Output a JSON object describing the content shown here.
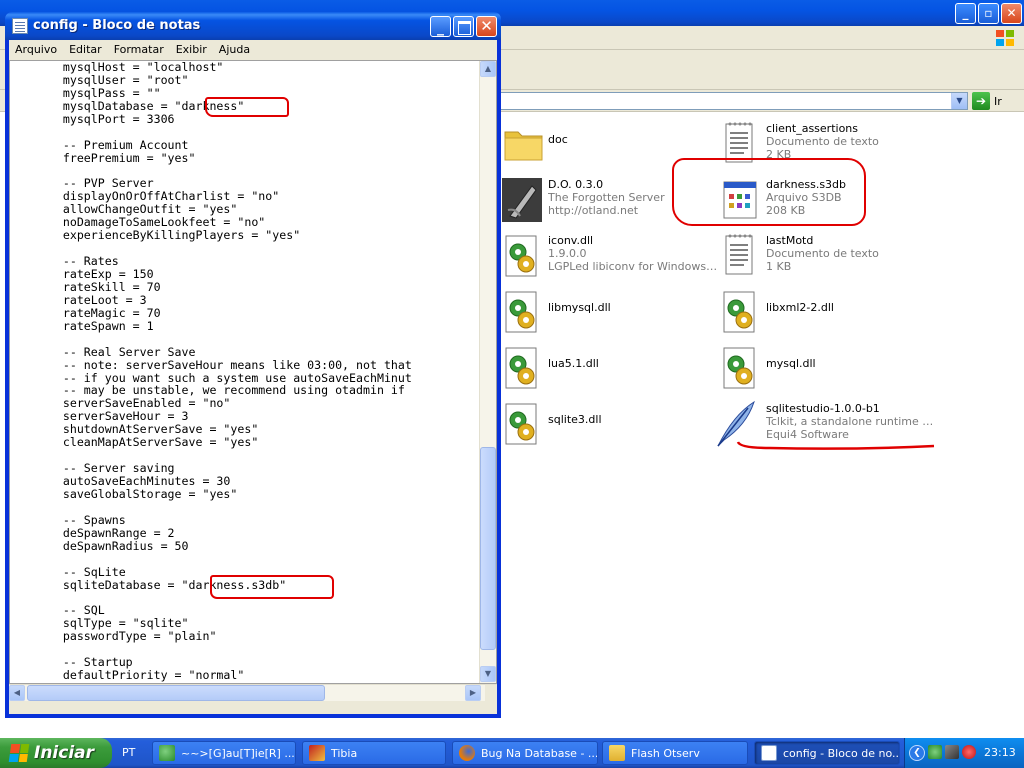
{
  "notepad": {
    "title": "config - Bloco de notas",
    "menu": [
      "Arquivo",
      "Editar",
      "Formatar",
      "Exibir",
      "Ajuda"
    ],
    "lines": [
      "       mysqlHost = \"localhost\"",
      "       mysqlUser = \"root\"",
      "       mysqlPass = \"\"",
      "       mysqlDatabase = \"darkness\"",
      "       mysqlPort = 3306",
      "",
      "       -- Premium Account",
      "       freePremium = \"yes\"",
      "",
      "       -- PVP Server",
      "       displayOnOrOffAtCharlist = \"no\"",
      "       allowChangeOutfit = \"yes\"",
      "       noDamageToSameLookfeet = \"no\"",
      "       experienceByKillingPlayers = \"yes\"",
      "",
      "       -- Rates",
      "       rateExp = 150",
      "       rateSkill = 70",
      "       rateLoot = 3",
      "       rateMagic = 70",
      "       rateSpawn = 1",
      "",
      "       -- Real Server Save",
      "       -- note: serverSaveHour means like 03:00, not that",
      "       -- if you want such a system use autoSaveEachMinut",
      "       -- may be unstable, we recommend using otadmin if",
      "       serverSaveEnabled = \"no\"",
      "       serverSaveHour = 3",
      "       shutdownAtServerSave = \"yes\"",
      "       cleanMapAtServerSave = \"yes\"",
      "",
      "       -- Server saving",
      "       autoSaveEachMinutes = 30",
      "       saveGlobalStorage = \"yes\"",
      "",
      "       -- Spawns",
      "       deSpawnRange = 2",
      "       deSpawnRadius = 50",
      "",
      "       -- SqLite",
      "       sqliteDatabase = \"darkness.s3db\"",
      "",
      "       -- SQL",
      "       sqlType = \"sqlite\"",
      "       passwordType = \"plain\"",
      "",
      "       -- Startup",
      "       defaultPriority = \"normal\""
    ]
  },
  "explorer": {
    "go_label": "Ir",
    "files": [
      {
        "name": "doc",
        "lines": [],
        "icon": "folder-icon"
      },
      {
        "name": "client_assertions",
        "lines": [
          "Documento de texto",
          "2 KB"
        ],
        "icon": "text-document-icon"
      },
      {
        "name": "D.O. 0.3.0",
        "lines": [
          "The Forgotten Server",
          "http://otland.net"
        ],
        "icon": "server-app-icon"
      },
      {
        "name": "darkness.s3db",
        "lines": [
          "Arquivo S3DB",
          "208 KB"
        ],
        "icon": "s3db-file-icon"
      },
      {
        "name": "iconv.dll",
        "lines": [
          "1.9.0.0",
          "LGPLed libiconv for Windows N..."
        ],
        "icon": "dll-icon"
      },
      {
        "name": "lastMotd",
        "lines": [
          "Documento de texto",
          "1 KB"
        ],
        "icon": "text-document-icon"
      },
      {
        "name": "libmysql.dll",
        "lines": [],
        "icon": "dll-icon"
      },
      {
        "name": "libxml2-2.dll",
        "lines": [],
        "icon": "dll-icon"
      },
      {
        "name": "lua5.1.dll",
        "lines": [],
        "icon": "dll-icon"
      },
      {
        "name": "mysql.dll",
        "lines": [],
        "icon": "dll-icon"
      },
      {
        "name": "sqlite3.dll",
        "lines": [],
        "icon": "dll-icon"
      },
      {
        "name": "sqlitestudio-1.0.0-b1",
        "lines": [
          "Tclkit, a standalone runtime fo...",
          "Equi4 Software"
        ],
        "icon": "feather-icon"
      }
    ]
  },
  "taskbar": {
    "start_label": "Iniciar",
    "language": "PT",
    "buttons": [
      {
        "label": "~~>[G]au[T]ie[R] ...",
        "icon": "messenger-icon"
      },
      {
        "label": "Tibia",
        "icon": "tibia-icon"
      },
      {
        "label": "Bug Na Database - ...",
        "icon": "firefox-icon"
      },
      {
        "label": "Flash Otserv",
        "icon": "folder-icon"
      },
      {
        "label": "config - Bloco de no...",
        "icon": "notepad-icon"
      }
    ],
    "clock": "23:13"
  },
  "colors": {
    "annotation": "#e00000",
    "title_bar": "#0554e3",
    "start_button": "#3c9c3c"
  }
}
